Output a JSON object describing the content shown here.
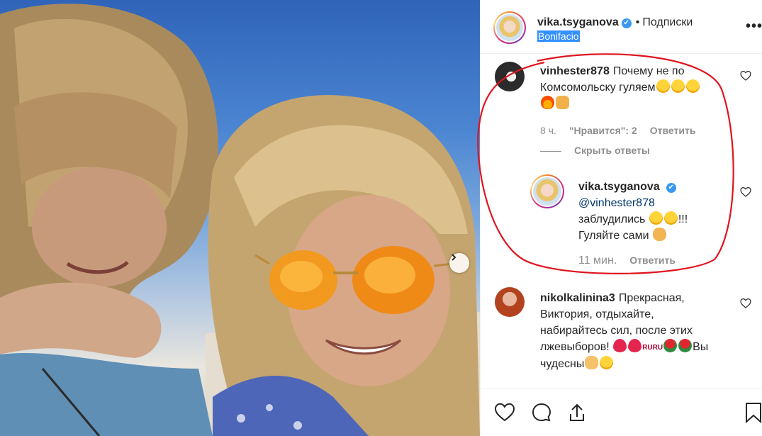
{
  "header": {
    "username": "vika.tsyganova",
    "verified_mark": "✔",
    "separator": "•",
    "follow_state": "Подписки",
    "location": "Bonifacio",
    "more_label": "•••"
  },
  "comments": [
    {
      "username": "vinhester878",
      "text_line1": "Почему не по",
      "text_line2": "Комсомольску гуляем",
      "time": "8 ч.",
      "likes": "\"Нравится\": 2",
      "reply_label": "Ответить",
      "hide_replies_label": "Скрыть ответы"
    },
    {
      "username": "vika.tsyganova",
      "verified_mark": "✔",
      "mention": "@vinhester878",
      "text_line1": "заблудились",
      "text_line1_suffix": "!!!",
      "text_line2": "Гуляйте сами",
      "time": "11 мин.",
      "reply_label": "Ответить"
    },
    {
      "username": "nikolkalinina3",
      "text_line1": "Прекрасная,",
      "text_line2": "Виктория, отдыхайте,",
      "text_line3": "набирайтесь сил, после этих",
      "text_line4": "лжевыборов!",
      "ru_text": "RURU",
      "text_line4_end": "Вы",
      "text_line5": "чудесны"
    }
  ],
  "icons": {
    "like": "heart-icon",
    "comment": "comment-icon",
    "share": "share-icon",
    "save": "bookmark-icon",
    "next": "chevron-right-icon",
    "more": "more-dots-icon"
  },
  "colors": {
    "annotation": "#e0141e",
    "mention": "#003569",
    "verified": "#3897f0",
    "location_highlight": "#3390ff"
  }
}
